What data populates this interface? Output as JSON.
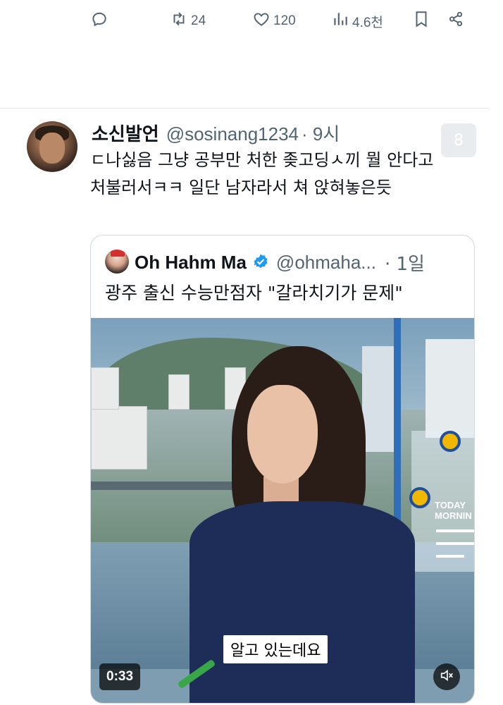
{
  "actions": {
    "reply_count": "",
    "retweet_count": "24",
    "like_count": "120",
    "view_count": "4.6천"
  },
  "tweet": {
    "display_name": "소신발언",
    "handle": "@sosinang1234",
    "time": "· 9시",
    "text": "ㄷ나싫음 그냥 공부만 처한 좆고딩ㅅ끼 뭘 안다고 처불러서ㅋㅋ 일단 남자라서 쳐 앉혀놓은듯",
    "badge": "8"
  },
  "quote": {
    "display_name": "Oh Hahm Ma",
    "handle": "@ohmaha...",
    "time": "· 1일",
    "text": "광주 출신 수능만점자 \"갈라치기가 문제\"",
    "video": {
      "subtitle": "알고 있는데요",
      "duration": "0:33",
      "overlay_text": "TODAY\nMORNIN"
    }
  },
  "colors": {
    "text": "#0f1419",
    "secondary": "#536471",
    "verified": "#1d9bf0",
    "border": "#cfd9de"
  },
  "icons": [
    "reply-icon",
    "retweet-icon",
    "like-icon",
    "views-icon",
    "bookmark-icon",
    "share-icon",
    "verified-icon",
    "mute-icon"
  ]
}
